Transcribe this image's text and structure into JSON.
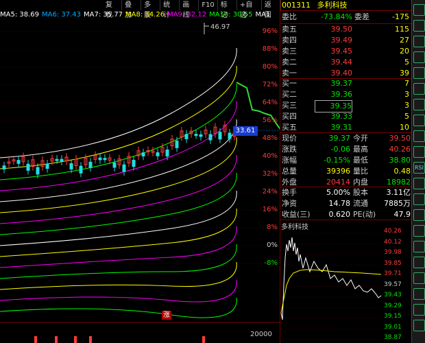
{
  "toolbar": [
    {
      "label": "复权"
    },
    {
      "label": "叠加"
    },
    {
      "label": "多股"
    },
    {
      "label": "统计"
    },
    {
      "label": "画线"
    },
    {
      "label": "F10"
    },
    {
      "label": "标记"
    },
    {
      "label": "+自选"
    },
    {
      "label": "返回"
    }
  ],
  "ma_legend": [
    {
      "text": "MA5: 38.69",
      "color": "#ffffff"
    },
    {
      "text": "MA6: 37.43",
      "color": "#00aaff"
    },
    {
      "text": "MA7: 35.77",
      "color": "#ffffff"
    },
    {
      "text": "MA8: 34.26",
      "color": "#ffff00"
    },
    {
      "text": "MA9: 32.12",
      "color": "#ff00ff"
    },
    {
      "text": "MA10: 30.55",
      "color": "#00ff00"
    },
    {
      "text": "MA1",
      "color": "#ffffff"
    }
  ],
  "chart": {
    "peak_label": "46.97",
    "current_price_label": "33.61",
    "zhang_label": "涨",
    "volume_label": "20000"
  },
  "right_axis": [
    "96%",
    "88%",
    "80%",
    "72%",
    "64%",
    "56%",
    "48%",
    "40%",
    "32%",
    "24%",
    "16%",
    "8%",
    "0%",
    "-8%"
  ],
  "quote": {
    "code": "001311",
    "name": "多利科技",
    "weibi_label": "委比",
    "weibi_value": "-73.84%",
    "weicha_label": "委差",
    "weicha_value": "-175",
    "asks": [
      {
        "label": "卖五",
        "price": "39.50",
        "vol": "115"
      },
      {
        "label": "卖四",
        "price": "39.49",
        "vol": "27"
      },
      {
        "label": "卖三",
        "price": "39.45",
        "vol": "20"
      },
      {
        "label": "卖二",
        "price": "39.44",
        "vol": "5"
      },
      {
        "label": "卖一",
        "price": "39.40",
        "vol": "39"
      }
    ],
    "bids": [
      {
        "label": "买一",
        "price": "39.37",
        "vol": "7"
      },
      {
        "label": "买二",
        "price": "39.36",
        "vol": "3"
      },
      {
        "label": "买三",
        "price": "39.35",
        "vol": "3"
      },
      {
        "label": "买四",
        "price": "39.33",
        "vol": "5"
      },
      {
        "label": "买五",
        "price": "39.31",
        "vol": "10"
      }
    ],
    "stats": [
      {
        "l1": "现价",
        "v1": "39.37",
        "c1": "green",
        "l2": "今开",
        "v2": "39.50",
        "c2": "red"
      },
      {
        "l1": "涨跌",
        "v1": "-0.06",
        "c1": "green",
        "l2": "最高",
        "v2": "40.26",
        "c2": "red"
      },
      {
        "l1": "涨幅",
        "v1": "-0.15%",
        "c1": "green",
        "l2": "最低",
        "v2": "38.80",
        "c2": "green"
      },
      {
        "l1": "总量",
        "v1": "39396",
        "c1": "yellow",
        "l2": "量比",
        "v2": "0.48",
        "c2": "yellow"
      },
      {
        "l1": "外盘",
        "v1": "20414",
        "c1": "red",
        "l2": "内盘",
        "v2": "18982",
        "c2": "green"
      }
    ],
    "stats2": [
      {
        "l1": "换手",
        "v1": "5.00%",
        "l2": "股本",
        "v2": "3.11亿"
      },
      {
        "l1": "净资",
        "v1": "14.78",
        "l2": "流通",
        "v2": "7885万"
      },
      {
        "l1": "收益(三)",
        "v1": "0.620",
        "l2": "PE(动)",
        "v2": "47.9"
      }
    ]
  },
  "mini_chart": {
    "title": "多利科技",
    "prices": [
      "40.26",
      "40.12",
      "39.98",
      "39.85",
      "39.71",
      "39.57",
      "39.43",
      "39.29",
      "39.15",
      "39.01",
      "38.87"
    ]
  }
}
